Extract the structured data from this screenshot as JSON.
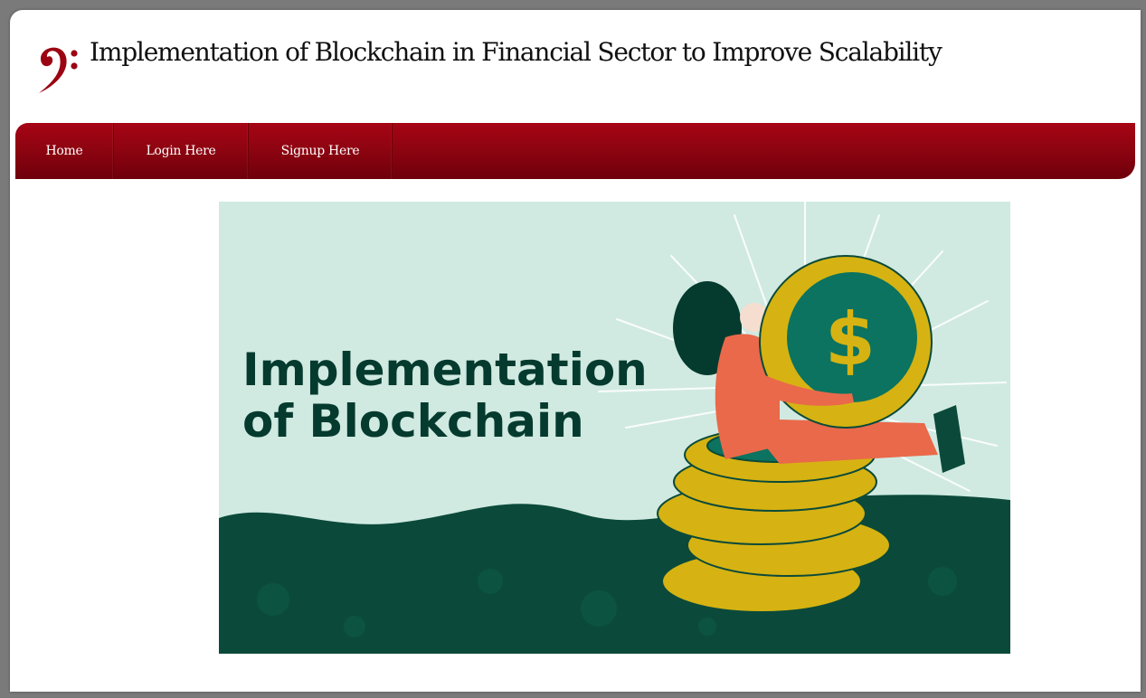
{
  "site": {
    "title": "Implementation of Blockchain in Financial Sector to Improve Scalability",
    "logo_icon": "bass-clef-icon",
    "brand_color": "#9b0412"
  },
  "nav": {
    "items": [
      {
        "label": "Home"
      },
      {
        "label": "Login Here"
      },
      {
        "label": "Signup Here"
      }
    ]
  },
  "banner": {
    "heading_line1": "Implementation",
    "heading_line2": "of Blockchain",
    "colors": {
      "background": "#d0eae1",
      "wave": "#0b4a3a",
      "coin": "#d6b312",
      "coin_center": "#0b7360",
      "figure_suit": "#e9694a"
    }
  }
}
